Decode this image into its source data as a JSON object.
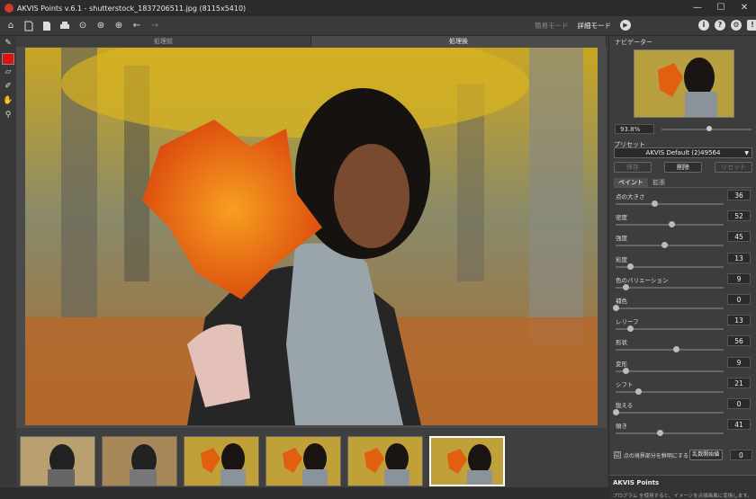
{
  "window": {
    "title": "AKVIS Points v.6.1 - shutterstock_1837206511.jpg (8115x5410)",
    "minimize": "—",
    "maximize": "☐",
    "close": "✕"
  },
  "toolbar": {
    "mode_simple": "簡易モード",
    "mode_advanced": "詳細モード",
    "run_icon": "▶",
    "about": "i",
    "help": "?",
    "settings": "⚙",
    "notify": "!"
  },
  "canvas": {
    "tab_before": "処理前",
    "tab_after": "処理後"
  },
  "navigator": {
    "header": "ナビゲーター",
    "zoom": "93.8%",
    "zoom_level": 0.5
  },
  "preset": {
    "label": "プリセット",
    "selected": "AKVIS Default (2)49564",
    "save": "保存",
    "delete": "削除",
    "reset": "リセット"
  },
  "tabs": {
    "paint": "ペイント",
    "extra": "拡張"
  },
  "params": [
    {
      "label": "点の大きさ",
      "value": "36",
      "level": 0.36
    },
    {
      "label": "密度",
      "value": "52",
      "level": 0.52
    },
    {
      "label": "強度",
      "value": "45",
      "level": 0.45
    },
    {
      "label": "彩度",
      "value": "13",
      "level": 0.13
    },
    {
      "label": "色のバリエーション",
      "value": "9",
      "level": 0.09
    },
    {
      "label": "補色",
      "value": "0",
      "level": 0.0
    },
    {
      "label": "レリーフ",
      "value": "13",
      "level": 0.13
    },
    {
      "label": "形状",
      "value": "56",
      "level": 0.56
    },
    {
      "label": "変形",
      "value": "9",
      "level": 0.09
    },
    {
      "label": "シフト",
      "value": "21",
      "level": 0.21
    },
    {
      "label": "鋭える",
      "value": "0",
      "level": 0.0
    },
    {
      "label": "傾き",
      "value": "41",
      "level": 0.41
    }
  ],
  "border_option": {
    "label": "点の境界部分を鮮明にする",
    "checked": "☑",
    "seed_button": "乱数開始値",
    "seed_value": "0"
  },
  "hint": {
    "title": "AKVIS Points",
    "text": "プログラム を使用すると、イメージを点描画風に変換します。"
  }
}
